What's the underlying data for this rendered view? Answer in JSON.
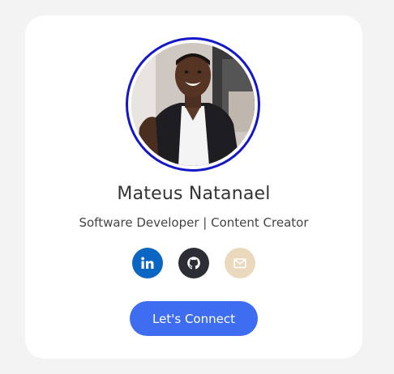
{
  "profile": {
    "name": "Mateus Natanael",
    "role": "Software Developer | Content Creator",
    "avatar_icon": "profile-photo"
  },
  "socials": [
    {
      "icon": "linkedin-icon",
      "color": "#0a66c2"
    },
    {
      "icon": "github-icon",
      "color": "#2b2f35"
    },
    {
      "icon": "email-icon",
      "color": "#ead8bf"
    }
  ],
  "cta": {
    "label": "Let's Connect",
    "color": "#3f6df2"
  },
  "colors": {
    "ring": "#1417c8",
    "card": "#ffffff",
    "background": "#f3f3f3"
  }
}
